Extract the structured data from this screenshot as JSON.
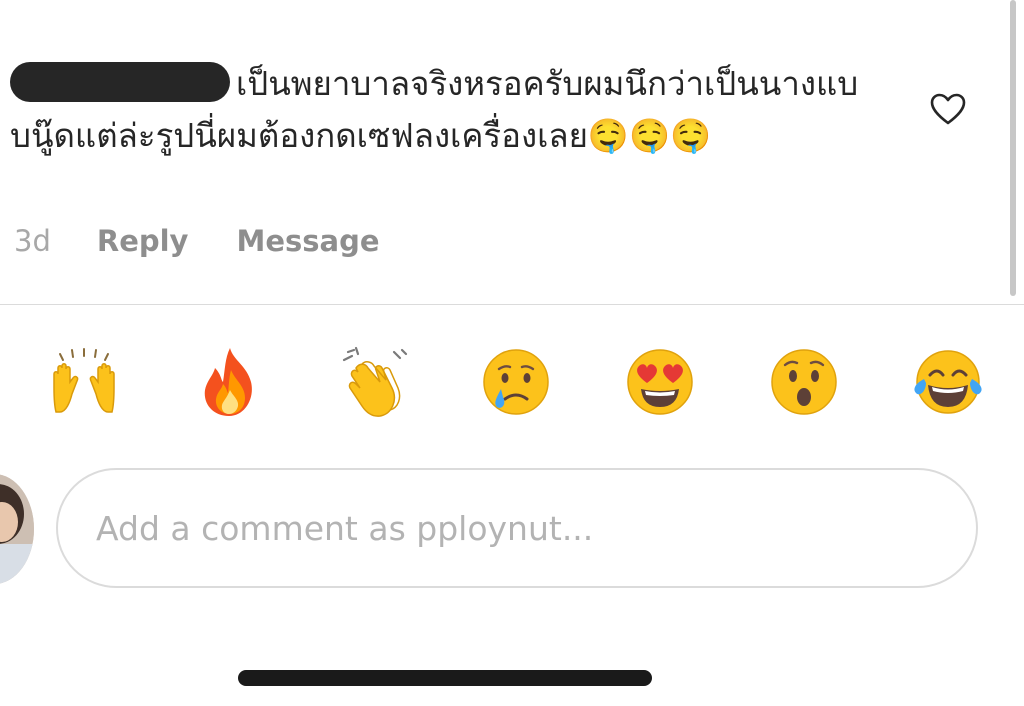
{
  "comment": {
    "username": "",
    "text": "เป็นพยาบาลจริงหรอครับผมนึกว่าเป็นนางแบบนู๊ดแต่ล่ะรูปนี่ผมต้องกดเซฟลงเครื่องเลย🤤🤤🤤",
    "time": "3d",
    "reply_label": "Reply",
    "message_label": "Message",
    "like_icon": "heart-outline-icon"
  },
  "quick_reactions": [
    {
      "emoji": "🙌",
      "name": "raised-hands-emoji"
    },
    {
      "emoji": "🔥",
      "name": "fire-emoji"
    },
    {
      "emoji": "👏",
      "name": "clapping-hands-emoji"
    },
    {
      "emoji": "😢",
      "name": "crying-face-emoji"
    },
    {
      "emoji": "😍",
      "name": "heart-eyes-emoji"
    },
    {
      "emoji": "😮",
      "name": "surprised-face-emoji"
    },
    {
      "emoji": "😂",
      "name": "tears-of-joy-emoji"
    }
  ],
  "composer": {
    "placeholder": "Add a comment as pploynut...",
    "value": ""
  },
  "colors": {
    "text": "#262626",
    "secondary": "#8e8e8e",
    "border": "#dbdbdb",
    "emoji_yellow": "#fcc21b"
  }
}
